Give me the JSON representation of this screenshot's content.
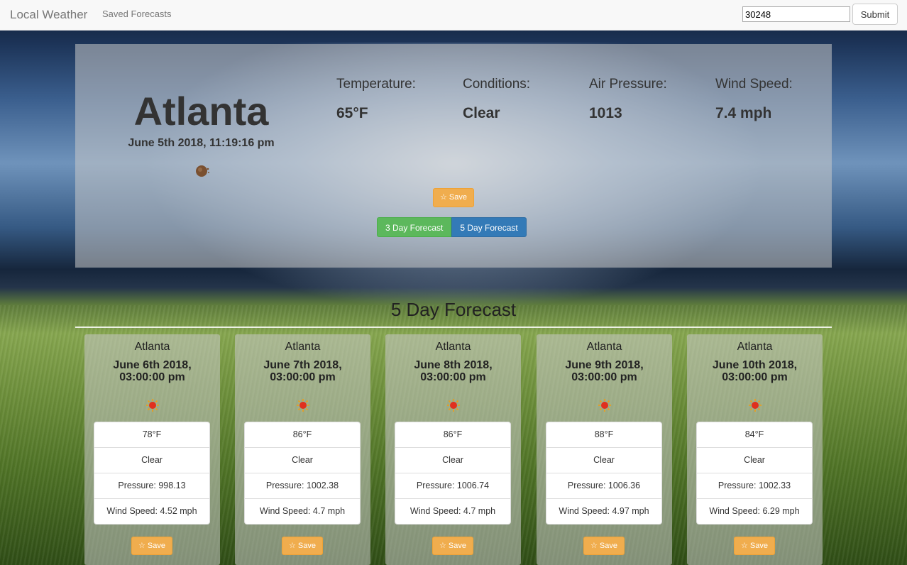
{
  "navbar": {
    "brand": "Local Weather",
    "saved_link": "Saved Forecasts",
    "zip_value": "30248",
    "submit_label": "Submit"
  },
  "current": {
    "city": "Atlanta",
    "datetime": "June 5th 2018, 11:19:16 pm",
    "icon": "moon-icon",
    "stats": [
      {
        "label": "Temperature:",
        "value": "65°F"
      },
      {
        "label": "Conditions:",
        "value": "Clear"
      },
      {
        "label": "Air Pressure:",
        "value": "1013"
      },
      {
        "label": "Wind Speed:",
        "value": "7.4 mph"
      }
    ],
    "save_label": "☆ Save",
    "three_day_label": "3 Day Forecast",
    "five_day_label": "5 Day Forecast"
  },
  "forecast": {
    "title": "5 Day Forecast",
    "days": [
      {
        "city": "Atlanta",
        "date": "June 6th 2018,",
        "time": "03:00:00 pm",
        "temp": "78°F",
        "conditions": "Clear",
        "pressure": "Pressure: 998.13",
        "wind": "Wind Speed: 4.52 mph",
        "save_label": "☆ Save"
      },
      {
        "city": "Atlanta",
        "date": "June 7th 2018,",
        "time": "03:00:00 pm",
        "temp": "86°F",
        "conditions": "Clear",
        "pressure": "Pressure: 1002.38",
        "wind": "Wind Speed: 4.7 mph",
        "save_label": "☆ Save"
      },
      {
        "city": "Atlanta",
        "date": "June 8th 2018,",
        "time": "03:00:00 pm",
        "temp": "86°F",
        "conditions": "Clear",
        "pressure": "Pressure: 1006.74",
        "wind": "Wind Speed: 4.7 mph",
        "save_label": "☆ Save"
      },
      {
        "city": "Atlanta",
        "date": "June 9th 2018,",
        "time": "03:00:00 pm",
        "temp": "88°F",
        "conditions": "Clear",
        "pressure": "Pressure: 1006.36",
        "wind": "Wind Speed: 4.97 mph",
        "save_label": "☆ Save"
      },
      {
        "city": "Atlanta",
        "date": "June 10th 2018,",
        "time": "03:00:00 pm",
        "temp": "84°F",
        "conditions": "Clear",
        "pressure": "Pressure: 1002.33",
        "wind": "Wind Speed: 6.29 mph",
        "save_label": "☆ Save"
      }
    ]
  },
  "colors": {
    "save": "#f0ad4e",
    "three_day": "#5cb85c",
    "five_day": "#337ab7"
  }
}
